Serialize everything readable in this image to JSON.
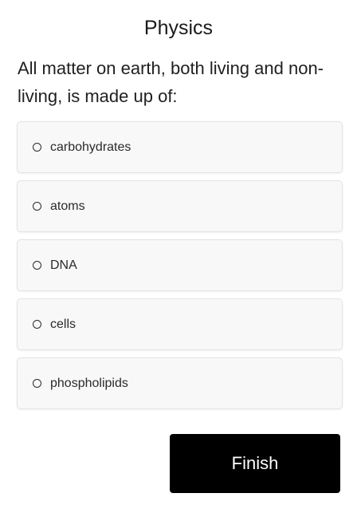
{
  "quiz": {
    "title": "Physics",
    "question": "All matter on earth, both living and non-living, is made up of:",
    "options": [
      {
        "label": "carbohydrates"
      },
      {
        "label": "atoms"
      },
      {
        "label": "DNA"
      },
      {
        "label": "cells"
      },
      {
        "label": "phospholipids"
      }
    ],
    "finish_label": "Finish"
  },
  "colors": {
    "option_background": "#f8f8f8",
    "option_border": "#e3e3e3",
    "button_background": "#000000",
    "button_text": "#ffffff"
  },
  "icons": {
    "option_marker": "radio-unselected-icon"
  }
}
